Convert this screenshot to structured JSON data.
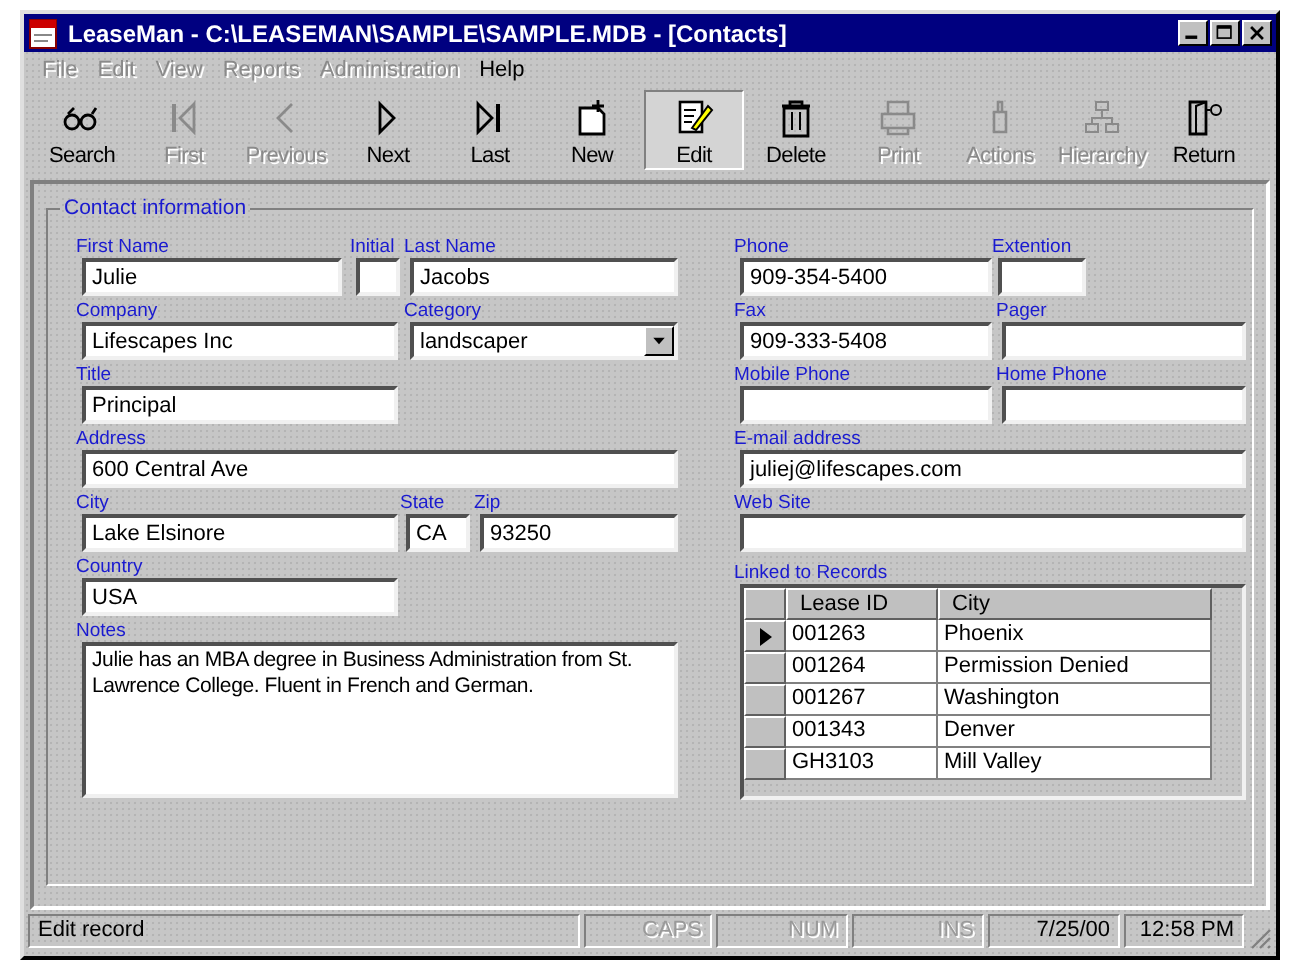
{
  "window": {
    "title": "LeaseMan - C:\\LEASEMAN\\SAMPLE\\SAMPLE.MDB - [Contacts]"
  },
  "menu": [
    {
      "label": "File",
      "disabled": true
    },
    {
      "label": "Edit",
      "disabled": true
    },
    {
      "label": "View",
      "disabled": true
    },
    {
      "label": "Reports",
      "disabled": true
    },
    {
      "label": "Administration",
      "disabled": true
    },
    {
      "label": "Help",
      "disabled": false
    }
  ],
  "toolbar": [
    {
      "label": "Search",
      "disabled": false,
      "selected": false
    },
    {
      "label": "First",
      "disabled": true,
      "selected": false
    },
    {
      "label": "Previous",
      "disabled": true,
      "selected": false
    },
    {
      "label": "Next",
      "disabled": false,
      "selected": false
    },
    {
      "label": "Last",
      "disabled": false,
      "selected": false
    },
    {
      "label": "New",
      "disabled": false,
      "selected": false
    },
    {
      "label": "Edit",
      "disabled": false,
      "selected": true
    },
    {
      "label": "Delete",
      "disabled": false,
      "selected": false
    },
    {
      "label": "Print",
      "disabled": true,
      "selected": false
    },
    {
      "label": "Actions",
      "disabled": true,
      "selected": false
    },
    {
      "label": "Hierarchy",
      "disabled": true,
      "selected": false
    },
    {
      "label": "Return",
      "disabled": false,
      "selected": false
    }
  ],
  "form": {
    "title": "Contact information",
    "left": [
      [
        {
          "label": "First Name",
          "value": "Julie",
          "kind": "text"
        },
        {
          "label": "Initial",
          "kind": "text"
        },
        {
          "label": "Last Name",
          "value": "Jacobs",
          "kind": "text"
        }
      ],
      [
        {
          "label": "Company",
          "value": "Lifescapes Inc",
          "kind": "text"
        },
        {
          "label": "Category",
          "value": "landscaper",
          "kind": "dropdown"
        }
      ],
      [
        {
          "label": "Title",
          "value": "Principal",
          "kind": "text"
        }
      ],
      [
        {
          "label": "Address",
          "value": "600 Central Ave",
          "kind": "text"
        }
      ],
      [
        {
          "label": "City",
          "value": "Lake Elsinore",
          "kind": "text"
        },
        {
          "label": "State",
          "value": "CA",
          "kind": "text"
        },
        {
          "label": "Zip",
          "value": "93250",
          "kind": "text"
        }
      ],
      [
        {
          "label": "Country",
          "value": "USA",
          "kind": "text"
        }
      ],
      [
        {
          "label": "Notes",
          "value": "Julie has an MBA degree in Business Administration from St. Lawrence College. Fluent in French and German.",
          "kind": "textarea"
        }
      ]
    ],
    "right": [
      [
        {
          "label": "Phone",
          "value": "909-354-5400",
          "kind": "text"
        },
        {
          "label": "Extention",
          "kind": "text"
        }
      ],
      [
        {
          "label": "Fax",
          "value": "909-333-5408",
          "kind": "text"
        },
        {
          "label": "Pager",
          "kind": "text"
        }
      ],
      [
        {
          "label": "Mobile Phone",
          "kind": "text"
        },
        {
          "label": "Home Phone",
          "kind": "text"
        }
      ],
      [
        {
          "label": "E-mail address",
          "value": "juliej@lifescapes.com",
          "kind": "text"
        }
      ],
      [
        {
          "label": "Web Site",
          "kind": "text"
        }
      ]
    ],
    "linked_records": {
      "label": "Linked to Records",
      "columns": [
        "Lease ID",
        "City"
      ],
      "rows": [
        {
          "cells": [
            "001263",
            "Phoenix"
          ],
          "selected": true
        },
        {
          "cells": [
            "001264",
            "Permission Denied"
          ],
          "selected": false
        },
        {
          "cells": [
            "001267",
            "Washington"
          ],
          "selected": false
        },
        {
          "cells": [
            "001343",
            "Denver"
          ],
          "selected": false
        },
        {
          "cells": [
            "GH3103",
            "Mill Valley"
          ],
          "selected": false
        }
      ]
    }
  },
  "status_bar": [
    {
      "text": "Edit record",
      "disabled": false
    },
    {
      "text": "CAPS",
      "disabled": true
    },
    {
      "text": "NUM",
      "disabled": true
    },
    {
      "text": "INS",
      "disabled": true
    },
    {
      "text": "7/25/00",
      "disabled": false
    },
    {
      "text": "12:58 PM",
      "disabled": false
    }
  ]
}
